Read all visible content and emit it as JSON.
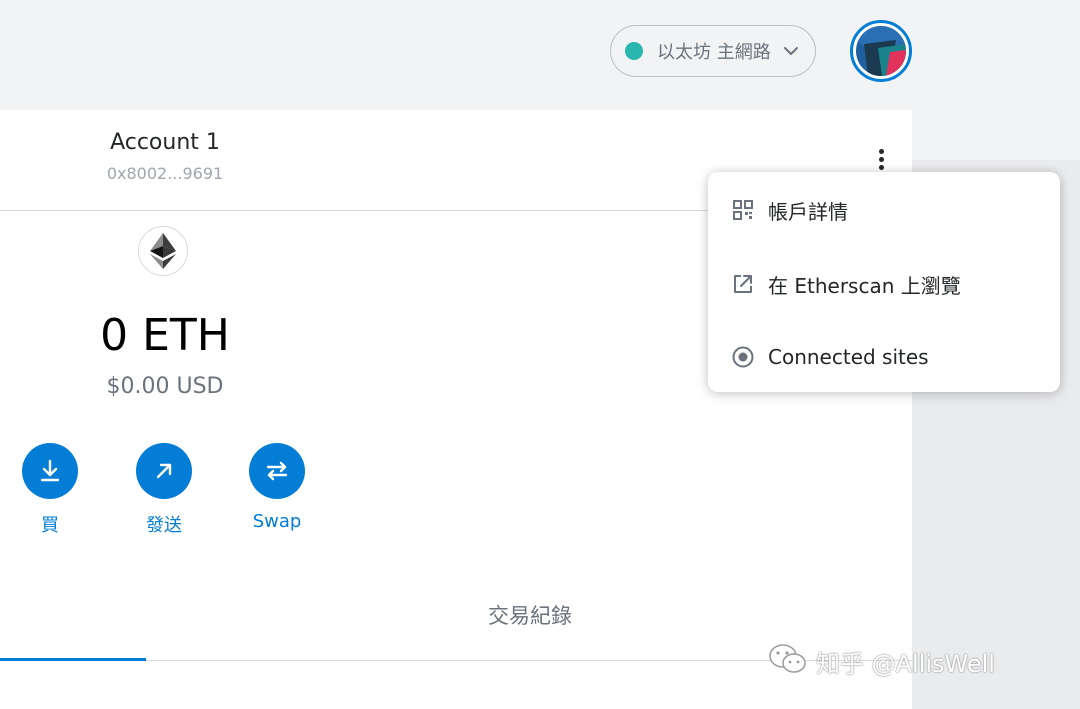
{
  "header": {
    "network": {
      "name": "以太坊 主網路",
      "dot_color": "#29b6af",
      "icon": "chevron-down-icon"
    },
    "avatar": {
      "icon": "account-identicon",
      "ring_color": "#037dd6"
    }
  },
  "account": {
    "name": "Account 1",
    "address": "0x8002...9691",
    "menu_icon": "kebab-menu-icon"
  },
  "balance": {
    "token_icon": "eth-logo-icon",
    "amount": "0 ETH",
    "fiat": "$0.00 USD"
  },
  "actions": [
    {
      "label": "買",
      "icon": "download-icon"
    },
    {
      "label": "發送",
      "icon": "arrow-up-right-icon"
    },
    {
      "label": "Swap",
      "icon": "swap-icon"
    }
  ],
  "tabs": {
    "activity": "交易紀錄"
  },
  "menu": {
    "items": [
      {
        "label": "帳戶詳情",
        "icon": "qr-code-icon"
      },
      {
        "label": "在 Etherscan 上瀏覽",
        "icon": "external-link-icon"
      },
      {
        "label": "Connected sites",
        "icon": "radio-dot-icon"
      }
    ]
  },
  "watermark": {
    "text": "知乎 @AllisWell",
    "icon": "wechat-icon"
  },
  "colors": {
    "primary": "#037dd6",
    "text_muted": "#6a737d",
    "background": "#f2f3f4"
  }
}
